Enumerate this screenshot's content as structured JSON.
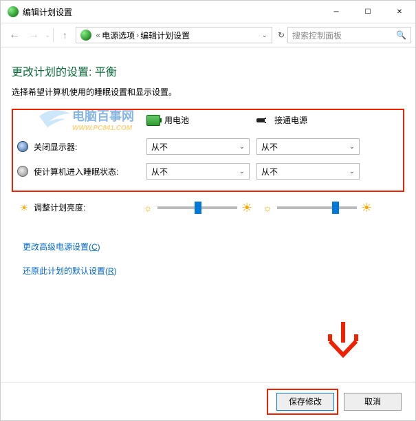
{
  "title": "编辑计划设置",
  "breadcrumb": {
    "parent": "电源选项",
    "current": "编辑计划设置"
  },
  "search_placeholder": "搜索控制面板",
  "heading": "更改计划的设置: 平衡",
  "subheading": "选择希望计算机使用的睡眠设置和显示设置。",
  "col": {
    "battery": "用电池",
    "plugged": "接通电源"
  },
  "rows": {
    "display_off": {
      "label": "关闭显示器:",
      "battery": "从不",
      "plugged": "从不"
    },
    "sleep": {
      "label": "使计算机进入睡眠状态:",
      "battery": "从不",
      "plugged": "从不"
    }
  },
  "brightness_label": "调整计划亮度:",
  "links": {
    "advanced": {
      "text": "更改高级电源设置(",
      "key": "C",
      "tail": ")"
    },
    "restore": {
      "text": "还原此计划的默认设置(",
      "key": "R",
      "tail": ")"
    }
  },
  "buttons": {
    "save": "保存修改",
    "cancel": "取消"
  },
  "watermark": {
    "main": "电脑百事网",
    "sub": "WWW.PC841.COM"
  }
}
